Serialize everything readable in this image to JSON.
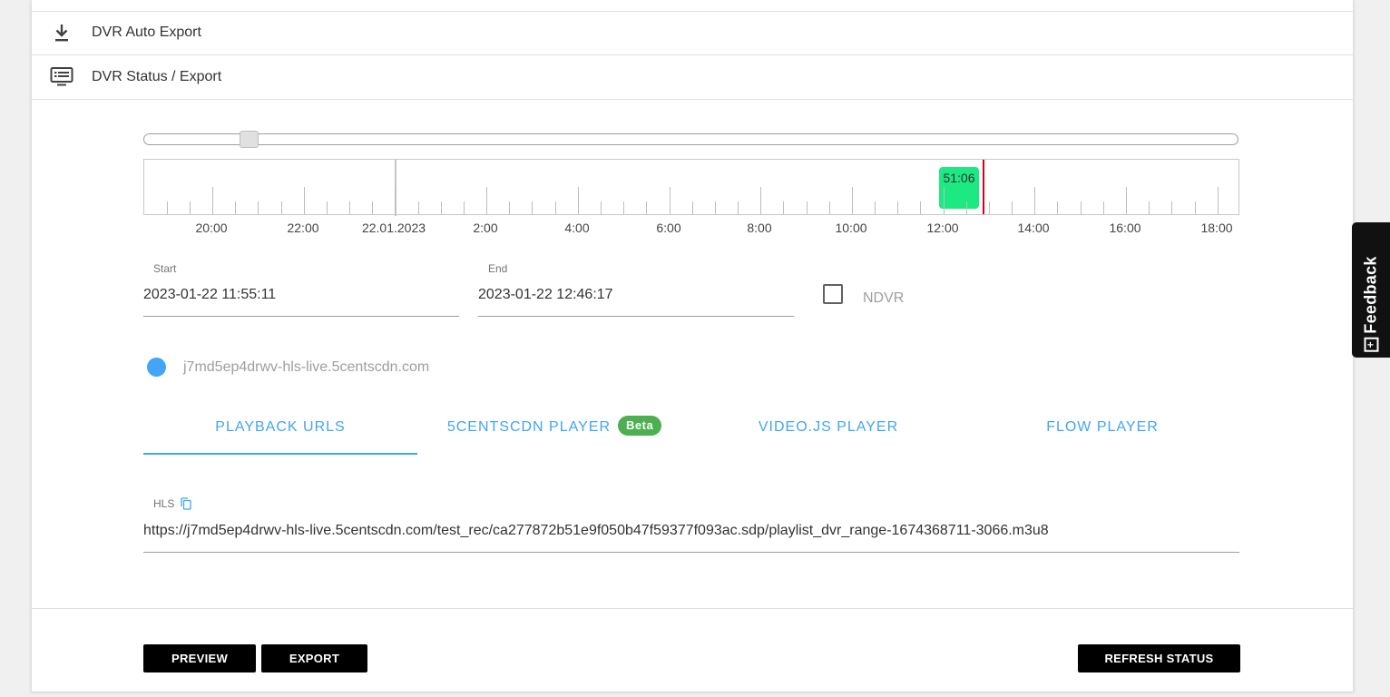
{
  "menu": {
    "auto_export": "DVR Auto Export",
    "status_export": "DVR Status / Export",
    "auto_export_icon": "download-icon",
    "status_export_icon": "list-monitor-icon"
  },
  "slider": {
    "position": 0.097
  },
  "timeline": {
    "labels": [
      "20:00",
      "22:00",
      "22.01.2023",
      "2:00",
      "4:00",
      "6:00",
      "8:00",
      "10:00",
      "12:00",
      "14:00",
      "16:00",
      "18:00"
    ],
    "segment_label": "51:06",
    "segment_color": "#1de982",
    "now_color": "#d0021b"
  },
  "fields": {
    "start_label": "Start",
    "start_value": "2023-01-22 11:55:11",
    "end_label": "End",
    "end_value": "2023-01-22 12:46:17",
    "ndvr_label": "NDVR",
    "ndvr_checked": false
  },
  "source": {
    "host": "j7md5ep4drwv-hls-live.5centscdn.com",
    "dot_color": "#42a5f5"
  },
  "tabs": {
    "playback": "PLAYBACK URLS",
    "cdn_player": "5CENTSCDN PLAYER",
    "beta": "Beta",
    "videojs": "VIDEO.JS PLAYER",
    "flow": "FLOW PLAYER",
    "active": "PLAYBACK URLS"
  },
  "hls": {
    "label": "HLS",
    "url": "https://j7md5ep4drwv-hls-live.5centscdn.com/test_rec/ca277872b51e9f050b47f59377f093ac.sdp/playlist_dvr_range-1674368711-3066.m3u8"
  },
  "buttons": {
    "preview": "PREVIEW",
    "export": "EXPORT",
    "refresh": "REFRESH STATUS"
  },
  "feedback": {
    "label": "Feedback"
  },
  "colors": {
    "accent": "#42a5f5",
    "beta": "#4caf50"
  }
}
